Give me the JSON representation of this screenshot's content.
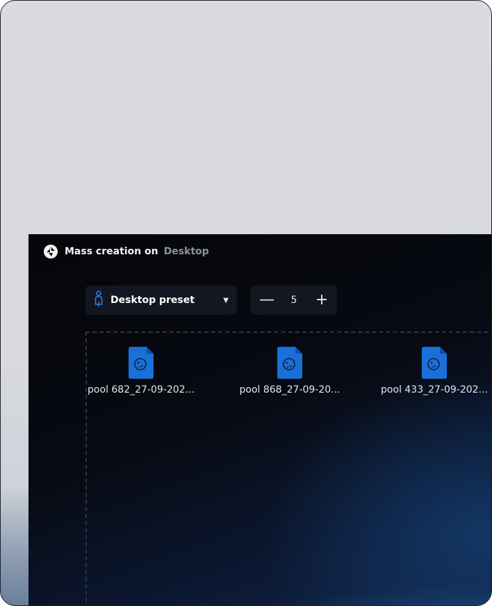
{
  "title": {
    "main": "Mass creation on",
    "sub": "Desktop"
  },
  "preset": {
    "label": "Desktop preset",
    "icon": "person-icon"
  },
  "stepper": {
    "minus": "—",
    "value": "5",
    "plus": "+"
  },
  "files": [
    {
      "name": "pool 682_27-09-202...",
      "icon": "cookie-file-icon"
    },
    {
      "name": "pool 868_27-09-20...",
      "icon": "cookie-file-icon"
    },
    {
      "name": "pool 433_27-09-202...",
      "icon": "cookie-file-icon"
    }
  ],
  "colors": {
    "accent": "#1b6fd8",
    "panel": "#121722"
  }
}
